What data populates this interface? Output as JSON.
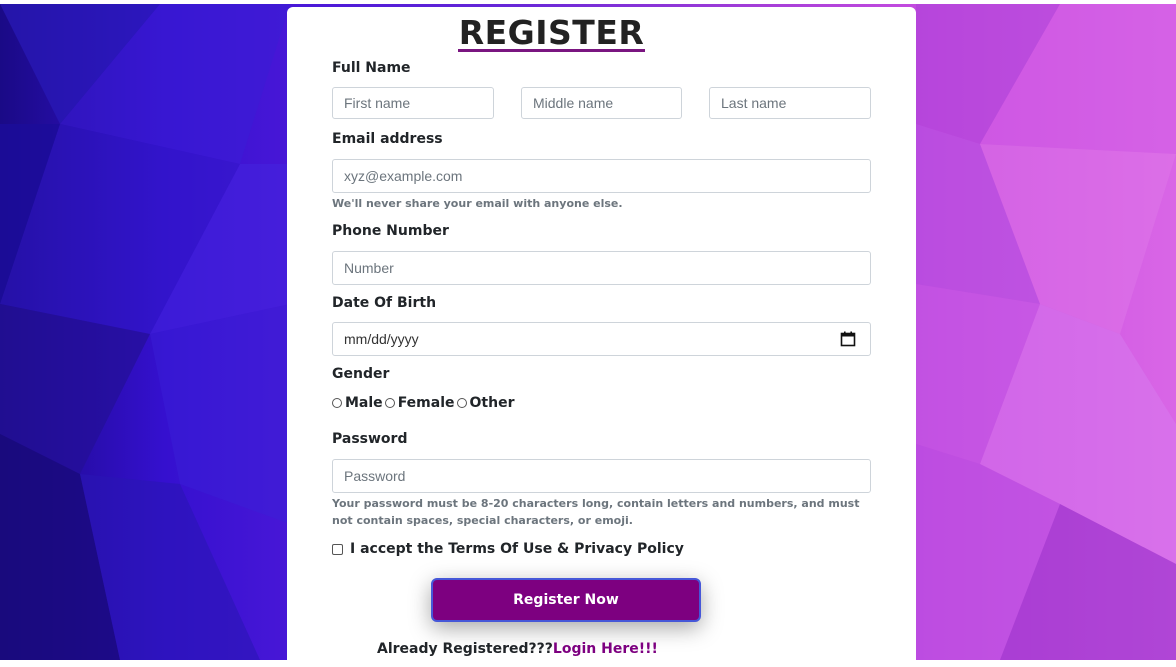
{
  "form": {
    "title": "REGISTER",
    "full_name": {
      "label": "Full Name",
      "first_placeholder": "First name",
      "middle_placeholder": "Middle name",
      "last_placeholder": "Last name"
    },
    "email": {
      "label": "Email address",
      "placeholder": "xyz@example.com",
      "help": "We'll never share your email with anyone else."
    },
    "phone": {
      "label": "Phone Number",
      "placeholder": "Number"
    },
    "dob": {
      "label": "Date Of Birth",
      "placeholder": "mm/dd/yyyy",
      "icon": "calendar-icon"
    },
    "gender": {
      "label": "Gender",
      "options": [
        "Male",
        "Female",
        "Other"
      ]
    },
    "password": {
      "label": "Password",
      "placeholder": "Password",
      "help": "Your password must be 8-20 characters long, contain letters and numbers, and must not contain spaces, special characters, or emoji."
    },
    "terms_label": "I accept the Terms Of Use & Privacy Policy",
    "submit_label": "Register Now",
    "footer": {
      "text": "Already Registered???",
      "link": "Login Here!!!"
    }
  },
  "colors": {
    "accent": "#7d0080",
    "button_border": "#4657d8",
    "bg_left": "#2a10c0",
    "bg_right": "#d966e6"
  }
}
